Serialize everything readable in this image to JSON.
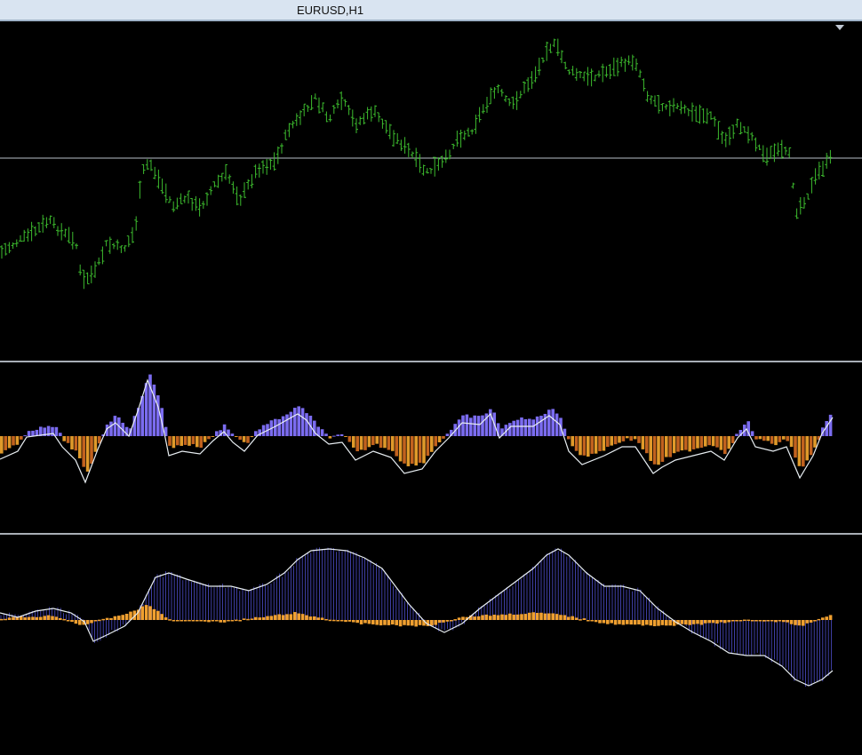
{
  "window": {
    "title": "EURUSD,H1"
  },
  "colors": {
    "background": "#000000",
    "price_bars": "#3dbb2e",
    "price_line": "#b9c0c8",
    "separator": "#a8aeb6",
    "indicator_line": "#e8eef2",
    "histogram_positive": "#7b6cf0",
    "histogram_negative": "#e09a2a",
    "histogram_negative_dark": "#c2621e",
    "histogram_orange": "#f0a030",
    "blue_lines": "#5c5cf0"
  },
  "icons": {
    "panel_arrow": "chevron-down-icon"
  }
}
